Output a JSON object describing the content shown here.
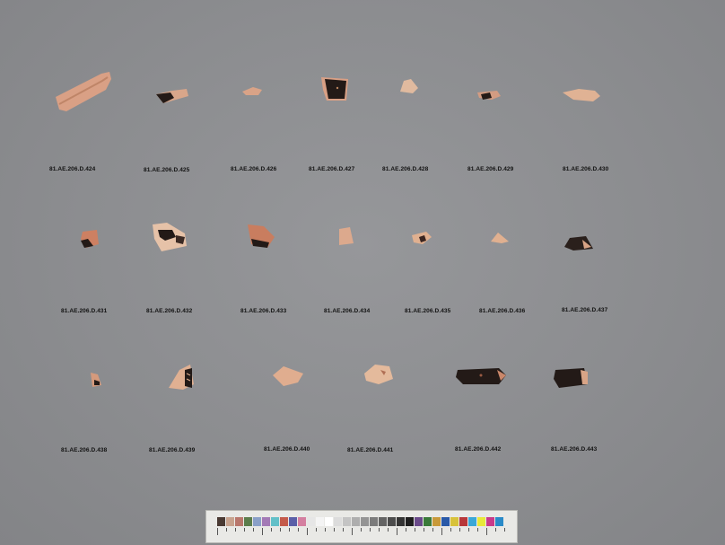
{
  "labels": [
    "81.AE.206.D.424",
    "81.AE.206.D.425",
    "81.AE.206.D.426",
    "81.AE.206.D.427",
    "81.AE.206.D.428",
    "81.AE.206.D.429",
    "81.AE.206.D.430",
    "81.AE.206.D.431",
    "81.AE.206.D.432",
    "81.AE.206.D.433",
    "81.AE.206.D.434",
    "81.AE.206.D.435",
    "81.AE.206.D.436",
    "81.AE.206.D.437",
    "81.AE.206.D.438",
    "81.AE.206.D.439",
    "81.AE.206.D.440",
    "81.AE.206.D.441",
    "81.AE.206.D.442",
    "81.AE.206.D.443"
  ],
  "colors": {
    "background": "#8a8b8d",
    "terracotta": "#d79a7c",
    "black_glaze": "#231a17"
  },
  "target_card": {
    "patch_colors": [
      "#4a3a33",
      "#c8a38e",
      "#b9776c",
      "#5c7d4c",
      "#8aa0c8",
      "#a37ab6",
      "#62c0c8",
      "#c45a4a",
      "#5b5fa8",
      "#d47fa0",
      "#e6e6e6",
      "#f4f4f4",
      "#ffffff",
      "#dcdcdc",
      "#c4c4c4",
      "#aeaeae",
      "#949494",
      "#7c7c7c",
      "#646464",
      "#4c4c4c",
      "#343434",
      "#1e1e1e",
      "#6a4a8a",
      "#3a7a3a",
      "#c89a3a",
      "#2a5aa8",
      "#d8c23a",
      "#b8383a",
      "#3aa8d8",
      "#e8e83a",
      "#c83a8a",
      "#2a8ac8"
    ]
  }
}
